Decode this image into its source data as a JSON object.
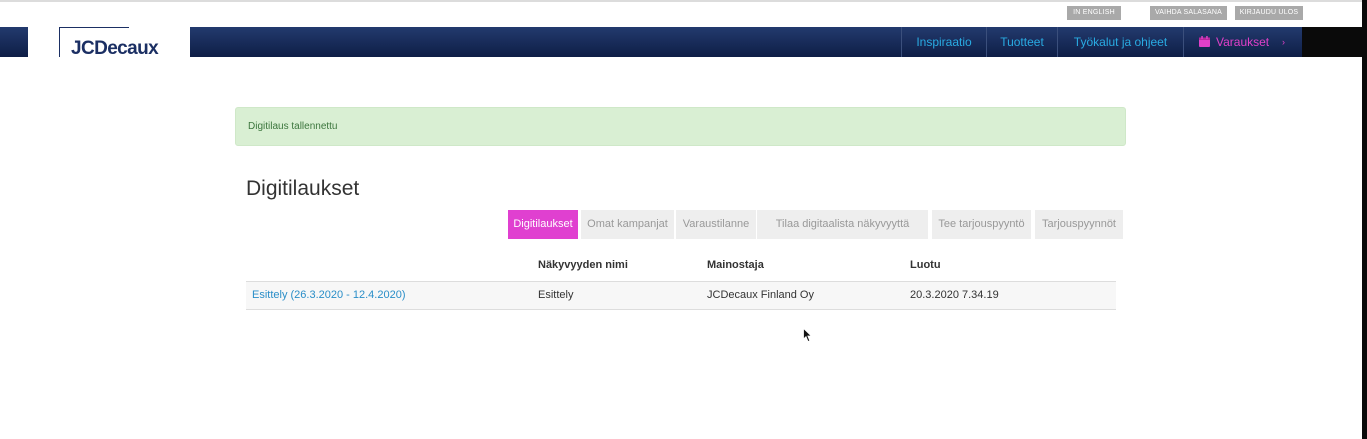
{
  "utility_links": {
    "english": "IN ENGLISH",
    "change_password": "VAIHDA SALASANA",
    "logout": "KIRJAUDU ULOS"
  },
  "brand": {
    "logo_text": "JCDecaux"
  },
  "nav": {
    "items": [
      "Inspiraatio",
      "Tuotteet",
      "Työkalut ja ohjeet"
    ],
    "bookings": "Varaukset",
    "bookings_icon": "calendar-icon",
    "chevron": "›"
  },
  "alert": {
    "message": "Digitilaus tallennettu"
  },
  "page": {
    "title": "Digitilaukset"
  },
  "tabs": [
    {
      "label": "Digitilaukset",
      "active": true
    },
    {
      "label": "Omat kampanjat",
      "active": false
    },
    {
      "label": "Varaustilanne",
      "active": false
    },
    {
      "label": "Tilaa digitaalista näkyvyyttä",
      "active": false
    },
    {
      "label": "Tee tarjouspyyntö",
      "active": false
    },
    {
      "label": "Tarjouspyynnöt",
      "active": false
    }
  ],
  "table": {
    "headers": [
      "",
      "Näkyvyyden nimi",
      "Mainostaja",
      "Luotu"
    ],
    "rows": [
      [
        "Esittely (26.3.2020 - 12.4.2020)",
        "Esittely",
        "JCDecaux Finland Oy",
        "20.3.2020 7.34.19"
      ]
    ]
  },
  "colors": {
    "nav_bg": "#1b2f63",
    "nav_link": "#29abe2",
    "accent_magenta": "#e040d0",
    "alert_bg": "#d9efd3",
    "alert_text": "#3c763d",
    "link": "#2a8ec8"
  }
}
